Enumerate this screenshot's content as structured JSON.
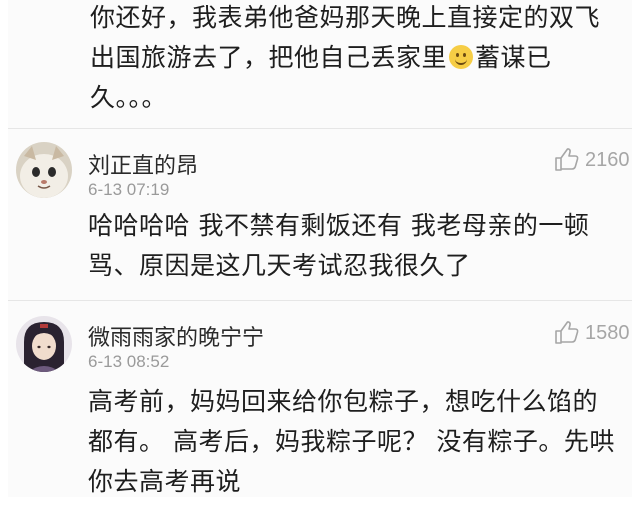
{
  "continued_comment": {
    "lines": [
      "你还好，我表弟他爸妈那天晚上直接定的双飞",
      "出国旅游去了，把他自己丢家里",
      "蓄谋已",
      "久。。。"
    ],
    "emoji": "smiling-face-emoji"
  },
  "comments": [
    {
      "username": "刘正直的昂",
      "timestamp": "6-13 07:19",
      "likes": "2160",
      "text_lines": [
        "哈哈哈哈 我不禁有剩饭还有 我老母亲的一顿",
        "骂、原因是这几天考试忍我很久了"
      ]
    },
    {
      "username": "微雨雨家的晚宁宁",
      "timestamp": "6-13 08:52",
      "likes": "1580",
      "text_lines": [
        "高考前，妈妈回来给你包粽子，想吃什么馅的",
        "都有。 高考后，妈我粽子呢？ 没有粽子。先哄",
        "你去高考再说"
      ]
    }
  ],
  "colors": {
    "text": "#1e1e1e",
    "meta": "#9a9a9a",
    "like": "#a6a6a6",
    "background": "#fbfbfb"
  }
}
